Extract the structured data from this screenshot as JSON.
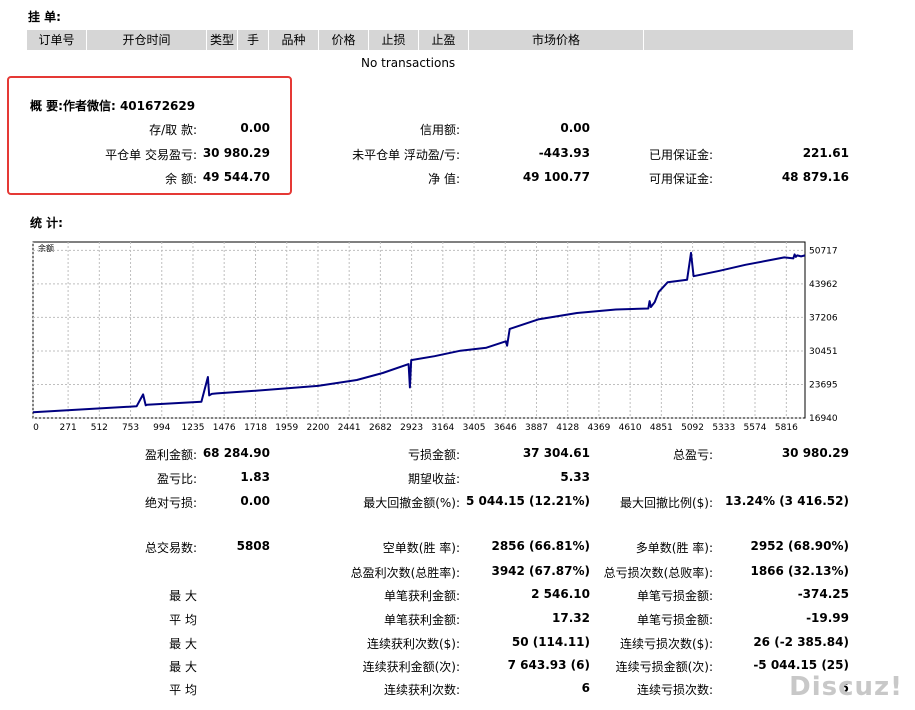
{
  "pending": {
    "title": "挂 单:",
    "columns": [
      "订单号",
      "开仓时间",
      "类型",
      "手",
      "品种",
      "价格",
      "止损",
      "止盈",
      "市场价格",
      ""
    ],
    "empty_text": "No transactions"
  },
  "summary": {
    "title": "概 要:作者微信: 401672629",
    "rows": [
      [
        {
          "label": "存/取 款:",
          "value": "0.00"
        },
        {
          "label": "信用额:",
          "value": "0.00"
        },
        {
          "label": "",
          "value": ""
        }
      ],
      [
        {
          "label": "平仓单 交易盈亏:",
          "value": "30 980.29"
        },
        {
          "label": "未平仓单 浮动盈/亏:",
          "value": "-443.93"
        },
        {
          "label": "已用保证金:",
          "value": "221.61"
        }
      ],
      [
        {
          "label": "余 额:",
          "value": "49 544.70"
        },
        {
          "label": "净 值:",
          "value": "49 100.77"
        },
        {
          "label": "可用保证金:",
          "value": "48 879.16"
        }
      ]
    ]
  },
  "stats": {
    "title": "统 计:",
    "rows": [
      [
        {
          "label": "盈利金额:",
          "value": "68 284.90"
        },
        {
          "label": "亏损金额:",
          "value": "37 304.61"
        },
        {
          "label": "总盈亏:",
          "value": "30 980.29"
        }
      ],
      [
        {
          "label": "盈亏比:",
          "value": "1.83"
        },
        {
          "label": "期望收益:",
          "value": "5.33"
        },
        {
          "label": "",
          "value": ""
        }
      ],
      [
        {
          "label": "绝对亏损:",
          "value": "0.00"
        },
        {
          "label": "最大回撤金额(%):",
          "value": "5 044.15 (12.21%)"
        },
        {
          "label": "最大回撤比例($):",
          "value": "13.24% (3 416.52)"
        }
      ],
      [
        {
          "label": "总交易数:",
          "value": "5808"
        },
        {
          "label": "空单数(胜 率):",
          "value": "2856 (66.81%)"
        },
        {
          "label": "多单数(胜 率):",
          "value": "2952 (68.90%)"
        }
      ],
      [
        {
          "label": "",
          "value": ""
        },
        {
          "label": "总盈利次数(总胜率):",
          "value": "3942 (67.87%)"
        },
        {
          "label": "总亏损次数(总败率):",
          "value": "1866 (32.13%)"
        }
      ],
      [
        {
          "label": "最 大",
          "value": ""
        },
        {
          "label": "单笔获利金额:",
          "value": "2 546.10"
        },
        {
          "label": "单笔亏损金额:",
          "value": "-374.25"
        }
      ],
      [
        {
          "label": "平 均",
          "value": ""
        },
        {
          "label": "单笔获利金额:",
          "value": "17.32"
        },
        {
          "label": "单笔亏损金额:",
          "value": "-19.99"
        }
      ],
      [
        {
          "label": "最 大",
          "value": ""
        },
        {
          "label": "连续获利次数($):",
          "value": "50 (114.11)"
        },
        {
          "label": "连续亏损次数($):",
          "value": "26 (-2 385.84)"
        }
      ],
      [
        {
          "label": "最 大",
          "value": ""
        },
        {
          "label": "连续获利金额(次):",
          "value": "7 643.93 (6)"
        },
        {
          "label": "连续亏损金额(次):",
          "value": "-5 044.15 (25)"
        }
      ],
      [
        {
          "label": "平 均",
          "value": ""
        },
        {
          "label": "连续获利次数:",
          "value": "6"
        },
        {
          "label": "连续亏损次数:",
          "value": "5"
        }
      ]
    ]
  },
  "chart_data": {
    "type": "line",
    "title": "",
    "corner_label": "余额",
    "xlabel": "",
    "ylabel": "",
    "xlim": [
      0,
      5960
    ],
    "ylim": [
      16940,
      52400
    ],
    "x_ticks": [
      0,
      271,
      512,
      753,
      994,
      1235,
      1476,
      1718,
      1959,
      2200,
      2441,
      2682,
      2923,
      3164,
      3405,
      3646,
      3887,
      4128,
      4369,
      4610,
      4851,
      5092,
      5333,
      5574,
      5816
    ],
    "y_ticks": [
      16940,
      23695,
      30451,
      37206,
      43962,
      50717
    ],
    "grid": true,
    "line_color": "#000080",
    "series": [
      {
        "name": "",
        "x": [
          0,
          800,
          850,
          870,
          880,
          1300,
          1350,
          1360,
          1380,
          1420,
          1700,
          2200,
          2500,
          2700,
          2900,
          2910,
          2920,
          3100,
          3300,
          3500,
          3650,
          3660,
          3680,
          3900,
          4200,
          4500,
          4750,
          4760,
          4770,
          4800,
          4830,
          4900,
          5050,
          5080,
          5100,
          5300,
          5500,
          5700,
          5800,
          5870,
          5880,
          5890,
          5900,
          5930,
          5960
        ],
        "y": [
          18100,
          19300,
          21700,
          19500,
          19600,
          20200,
          25200,
          21500,
          21800,
          21900,
          22400,
          23400,
          24600,
          26000,
          27800,
          23100,
          28600,
          29400,
          30500,
          31100,
          32400,
          31500,
          34900,
          36800,
          38100,
          38800,
          39000,
          40500,
          39300,
          40300,
          42300,
          44300,
          44800,
          50200,
          45500,
          46600,
          47800,
          48800,
          49300,
          49100,
          49900,
          49400,
          49700,
          49500,
          49700
        ]
      }
    ]
  },
  "watermark": "Discuz!"
}
